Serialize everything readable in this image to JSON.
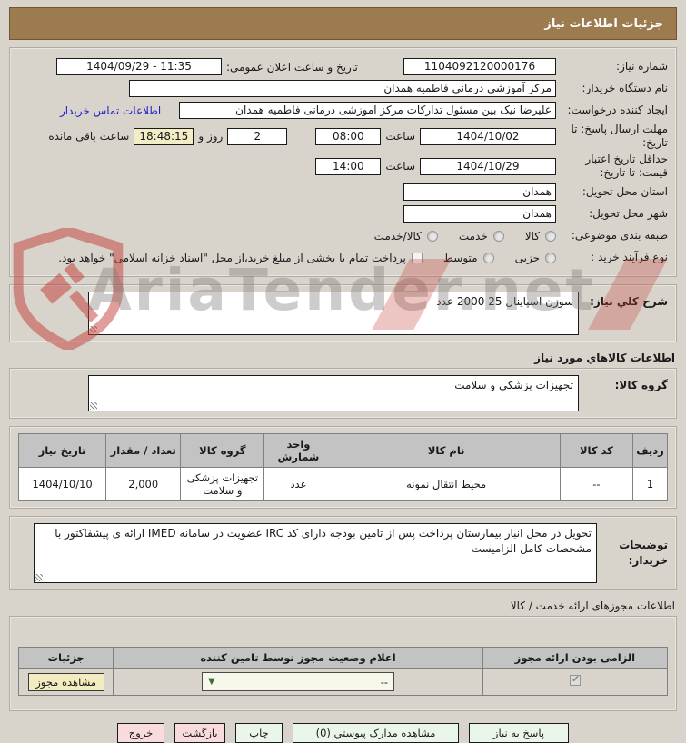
{
  "title": "جزئیات اطلاعات نیاز",
  "watermark": {
    "text": "AriaTender.net"
  },
  "colors": {
    "titlebar": "#9c7b4f",
    "countdown_bg": "#f2edc5",
    "link_blue": "#2222cc",
    "table_header_bg": "#c3c3c3",
    "button_green": "#e9f6e9",
    "button_pink": "#f8dbdb",
    "beige_button": "#f2ecc0"
  },
  "main_form": {
    "need_number": {
      "label": "شماره نیاز:",
      "value": "1104092120000176"
    },
    "announce": {
      "label": "تاریخ و ساعت اعلان عمومی:",
      "value": "1404/09/29 - 11:35"
    },
    "buyer_org": {
      "label": "نام دستگاه خریدار:",
      "value": "مرکز آموزشی درمانی فاطمیه همدان"
    },
    "creator": {
      "label": "ایجاد کننده درخواست:",
      "value": "علیرضا نیک بین مسئول تدارکات مرکز آموزشی درمانی فاطمیه همدان",
      "contact_link": "اطلاعات تماس خریدار"
    },
    "deadline": {
      "label": "مهلت ارسال پاسخ: تا تاریخ:",
      "date": "1404/10/02",
      "time_label": "ساعت",
      "time": "08:00",
      "days_value": "2",
      "days_and_label": "روز و",
      "countdown": "18:48:15",
      "remaining_label": "ساعت باقی مانده"
    },
    "price_validity": {
      "label": "حداقل تاریخ اعتبار قیمت: تا تاریخ:",
      "date": "1404/10/29",
      "time_label": "ساعت",
      "time": "14:00"
    },
    "province": {
      "label": "استان محل تحویل:",
      "value": "همدان"
    },
    "city": {
      "label": "شهر محل تحویل:",
      "value": "همدان"
    },
    "subject_class": {
      "label": "طبقه بندی موضوعی:",
      "options": [
        "کالا",
        "خدمت",
        "کالا/خدمت"
      ]
    },
    "process_type": {
      "label": "نوع فرآیند خرید :",
      "options": [
        "جزیی",
        "متوسط"
      ],
      "treasury_note": "پرداخت تمام یا بخشی از مبلغ خرید،از محل \"اسناد خزانه اسلامی\" خواهد بود."
    }
  },
  "need_desc": {
    "label": "شرح کلي نیاز:",
    "value": "سوزن اسپاینال 25     2000 عدد"
  },
  "goods_info": {
    "header": "اطلاعات کالاهاي مورد نیاز",
    "group_label": "گروه کالا:",
    "group_value": "تجهیزات پزشکی و سلامت",
    "table": {
      "headers": [
        "ردیف",
        "کد کالا",
        "نام کالا",
        "واحد شمارش",
        "گروه کالا",
        "تعداد / مقدار",
        "تاریخ نیاز"
      ],
      "row": [
        "1",
        "--",
        "محیط انتقال نمونه",
        "عدد",
        "تجهیزات پزشکی و سلامت",
        "2,000",
        "1404/10/10"
      ]
    },
    "buyer_notes_label": "توضیحات خریدار:",
    "buyer_notes": "تحویل در محل انبار بیمارستان پرداخت پس از تامین بودجه دارای کد IRC عضویت در سامانه IMED  ارائه ی پیشفاکتور با مشخصات کامل الزامیست"
  },
  "license_info": {
    "header": "اطلاعات مجوزهای ارائه خدمت / کالا",
    "table_headers": [
      "الزامی بودن ارائه مجوز",
      "اعلام وضعیت مجوز توسط تامین کننده",
      "جزئیات"
    ],
    "status_select_value": "--",
    "details_button": "مشاهده مجوز"
  },
  "footer": {
    "buttons": [
      "پاسخ به نیاز",
      "مشاهده مدارک پیوستي (0)",
      "چاپ",
      "بازگشت",
      "خروج"
    ]
  }
}
